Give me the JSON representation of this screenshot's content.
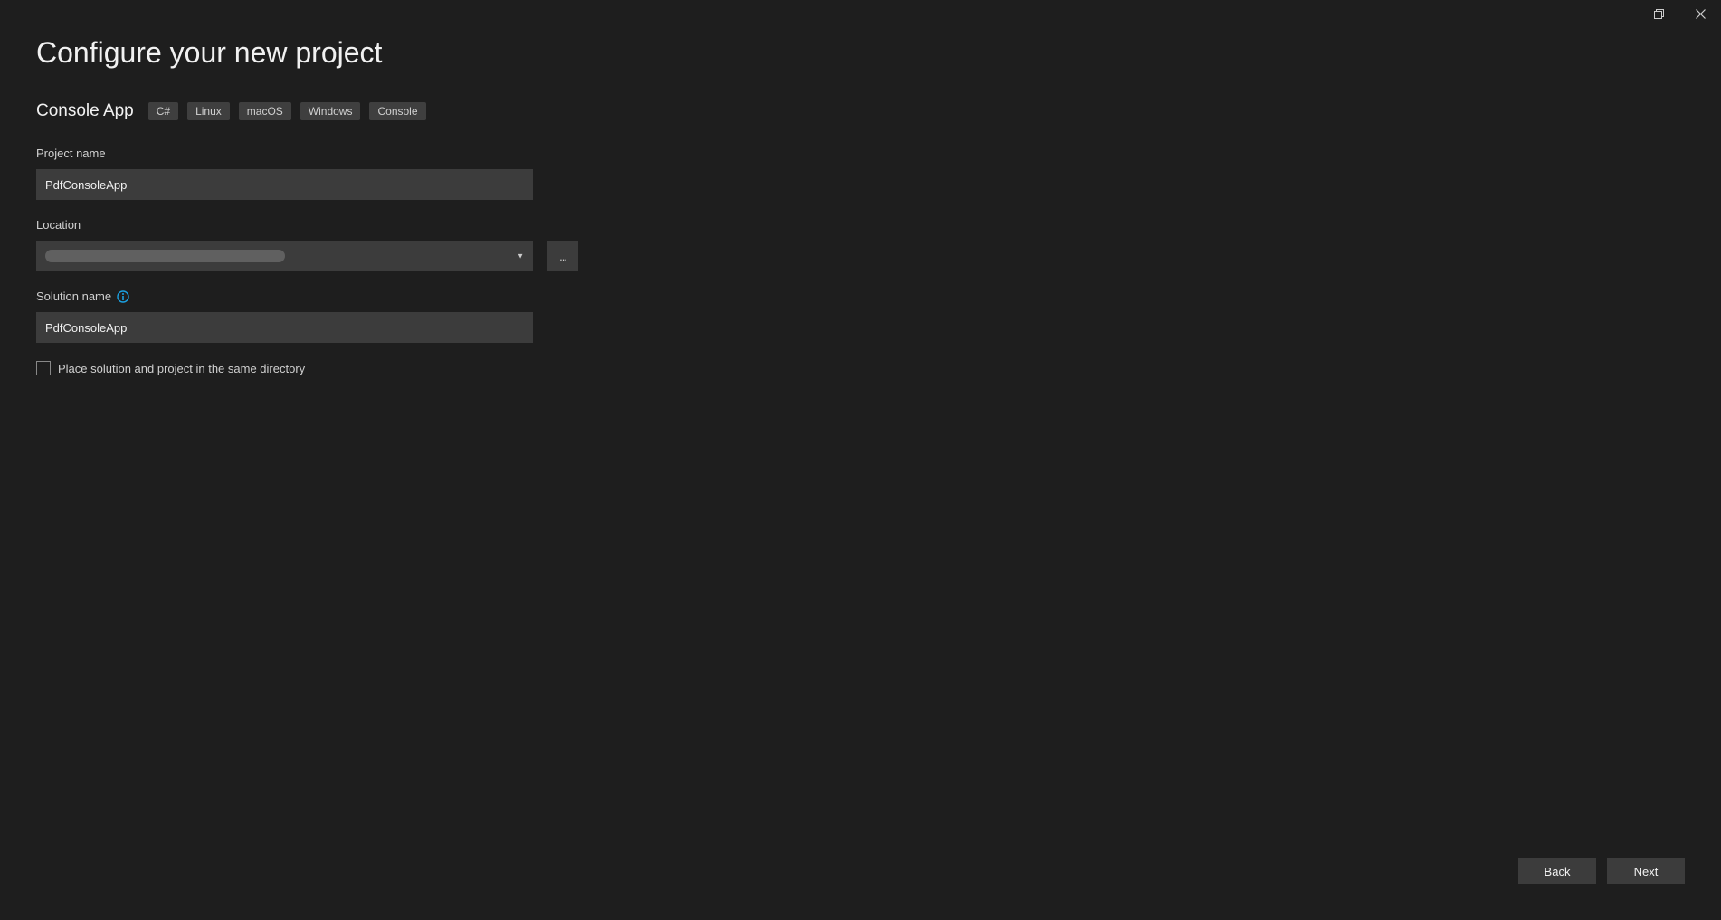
{
  "titlebar": {
    "maximize_icon": "maximize",
    "close_icon": "close"
  },
  "page": {
    "title": "Configure your new project"
  },
  "project_template": {
    "name": "Console App",
    "tags": [
      "C#",
      "Linux",
      "macOS",
      "Windows",
      "Console"
    ]
  },
  "form": {
    "project_name": {
      "label": "Project name",
      "value": "PdfConsoleApp"
    },
    "location": {
      "label": "Location",
      "browse_label": "..."
    },
    "solution_name": {
      "label": "Solution name",
      "value": "PdfConsoleApp"
    },
    "same_directory": {
      "label": "Place solution and project in the same directory",
      "checked": false
    }
  },
  "footer": {
    "back_label": "Back",
    "next_label": "Next"
  }
}
